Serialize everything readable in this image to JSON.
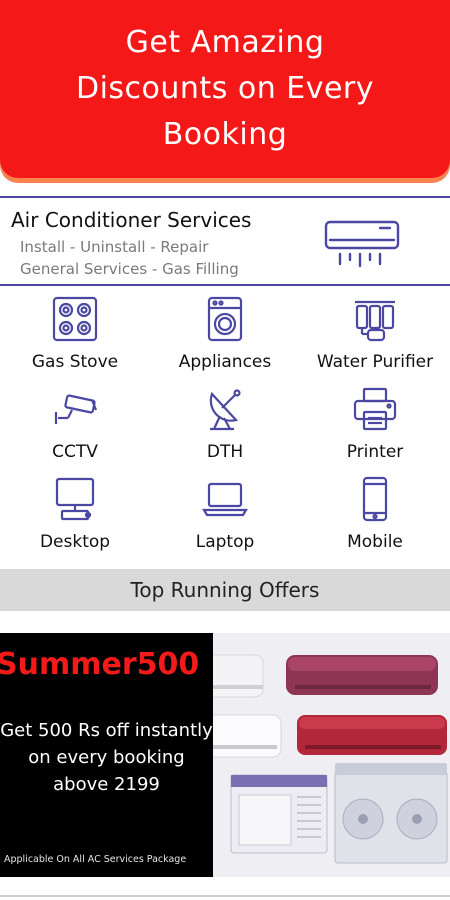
{
  "hero": {
    "text": "Get Amazing Discounts on Every Booking"
  },
  "ac_service": {
    "title": "Air Conditioner Services",
    "line1": "Install - Uninstall - Repair",
    "line2": "General Services - Gas Filling",
    "icon": "air-conditioner-icon"
  },
  "services": [
    {
      "label": "Gas Stove",
      "icon": "gas-stove-icon"
    },
    {
      "label": "Appliances",
      "icon": "washing-machine-icon"
    },
    {
      "label": "Water Purifier",
      "icon": "water-purifier-icon"
    },
    {
      "label": "CCTV",
      "icon": "cctv-camera-icon"
    },
    {
      "label": "DTH",
      "icon": "satellite-dish-icon"
    },
    {
      "label": "Printer",
      "icon": "printer-icon"
    },
    {
      "label": "Desktop",
      "icon": "desktop-icon"
    },
    {
      "label": "Laptop",
      "icon": "laptop-icon"
    },
    {
      "label": "Mobile",
      "icon": "mobile-icon"
    }
  ],
  "offers": {
    "heading": "Top Running Offers",
    "banner": {
      "code": "Summer500",
      "description": "Get 500 Rs off instantly on every booking above 2199",
      "note": "Applicable On All AC Services Package"
    }
  },
  "colors": {
    "brand_red": "#f51818",
    "icon_blue": "#4a48a3",
    "hero_shadow": "#f7834f"
  }
}
